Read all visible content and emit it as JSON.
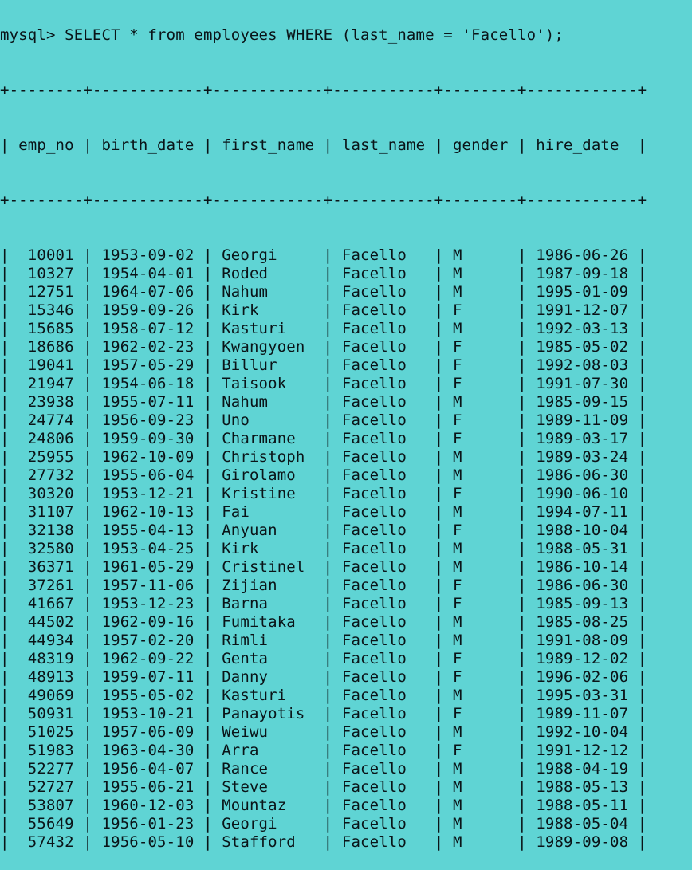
{
  "prompt": "mysql> ",
  "query": "SELECT * from employees WHERE (last_name = 'Facello');",
  "columns": [
    "emp_no",
    "birth_date",
    "first_name",
    "last_name",
    "gender",
    "hire_date"
  ],
  "rows": [
    [
      "10001",
      "1953-09-02",
      "Georgi",
      "Facello",
      "M",
      "1986-06-26"
    ],
    [
      "10327",
      "1954-04-01",
      "Roded",
      "Facello",
      "M",
      "1987-09-18"
    ],
    [
      "12751",
      "1964-07-06",
      "Nahum",
      "Facello",
      "M",
      "1995-01-09"
    ],
    [
      "15346",
      "1959-09-26",
      "Kirk",
      "Facello",
      "F",
      "1991-12-07"
    ],
    [
      "15685",
      "1958-07-12",
      "Kasturi",
      "Facello",
      "M",
      "1992-03-13"
    ],
    [
      "18686",
      "1962-02-23",
      "Kwangyoen",
      "Facello",
      "F",
      "1985-05-02"
    ],
    [
      "19041",
      "1957-05-29",
      "Billur",
      "Facello",
      "F",
      "1992-08-03"
    ],
    [
      "21947",
      "1954-06-18",
      "Taisook",
      "Facello",
      "F",
      "1991-07-30"
    ],
    [
      "23938",
      "1955-07-11",
      "Nahum",
      "Facello",
      "M",
      "1985-09-15"
    ],
    [
      "24774",
      "1956-09-23",
      "Uno",
      "Facello",
      "F",
      "1989-11-09"
    ],
    [
      "24806",
      "1959-09-30",
      "Charmane",
      "Facello",
      "F",
      "1989-03-17"
    ],
    [
      "25955",
      "1962-10-09",
      "Christoph",
      "Facello",
      "M",
      "1989-03-24"
    ],
    [
      "27732",
      "1955-06-04",
      "Girolamo",
      "Facello",
      "M",
      "1986-06-30"
    ],
    [
      "30320",
      "1953-12-21",
      "Kristine",
      "Facello",
      "F",
      "1990-06-10"
    ],
    [
      "31107",
      "1962-10-13",
      "Fai",
      "Facello",
      "M",
      "1994-07-11"
    ],
    [
      "32138",
      "1955-04-13",
      "Anyuan",
      "Facello",
      "F",
      "1988-10-04"
    ],
    [
      "32580",
      "1953-04-25",
      "Kirk",
      "Facello",
      "M",
      "1988-05-31"
    ],
    [
      "36371",
      "1961-05-29",
      "Cristinel",
      "Facello",
      "M",
      "1986-10-14"
    ],
    [
      "37261",
      "1957-11-06",
      "Zijian",
      "Facello",
      "F",
      "1986-06-30"
    ],
    [
      "41667",
      "1953-12-23",
      "Barna",
      "Facello",
      "F",
      "1985-09-13"
    ],
    [
      "44502",
      "1962-09-16",
      "Fumitaka",
      "Facello",
      "M",
      "1985-08-25"
    ],
    [
      "44934",
      "1957-02-20",
      "Rimli",
      "Facello",
      "M",
      "1991-08-09"
    ],
    [
      "48319",
      "1962-09-22",
      "Genta",
      "Facello",
      "F",
      "1989-12-02"
    ],
    [
      "48913",
      "1959-07-11",
      "Danny",
      "Facello",
      "F",
      "1996-02-06"
    ],
    [
      "49069",
      "1955-05-02",
      "Kasturi",
      "Facello",
      "M",
      "1995-03-31"
    ],
    [
      "50931",
      "1953-10-21",
      "Panayotis",
      "Facello",
      "F",
      "1989-11-07"
    ],
    [
      "51025",
      "1957-06-09",
      "Weiwu",
      "Facello",
      "M",
      "1992-10-04"
    ],
    [
      "51983",
      "1963-04-30",
      "Arra",
      "Facello",
      "F",
      "1991-12-12"
    ],
    [
      "52277",
      "1956-04-07",
      "Rance",
      "Facello",
      "M",
      "1988-04-19"
    ],
    [
      "52727",
      "1955-06-21",
      "Steve",
      "Facello",
      "M",
      "1988-05-13"
    ],
    [
      "53807",
      "1960-12-03",
      "Mountaz",
      "Facello",
      "M",
      "1988-05-11"
    ],
    [
      "55649",
      "1956-01-23",
      "Georgi",
      "Facello",
      "M",
      "1988-05-04"
    ],
    [
      "57432",
      "1956-05-10",
      "Stafford",
      "Facello",
      "M",
      "1989-09-08"
    ]
  ],
  "colors": {
    "background": "#5fd4d4",
    "text": "#0a1418"
  }
}
